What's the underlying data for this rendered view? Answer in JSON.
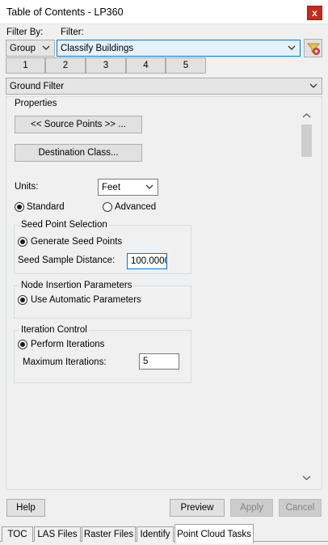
{
  "window": {
    "title": "Table of Contents - LP360",
    "close_label": "x"
  },
  "filter": {
    "filter_by_label": "Filter By:",
    "filter_label": "Filter:",
    "group_value": "Group",
    "filter_value": "Classify Buildings"
  },
  "number_tabs": [
    "1",
    "2",
    "3",
    "4",
    "5"
  ],
  "task_select": "Ground Filter",
  "properties": {
    "legend": "Properties",
    "source_points_label": "<< Source Points >> ...",
    "destination_class_label": "Destination Class...",
    "units_label": "Units:",
    "units_value": "Feet",
    "standard_label": "Standard",
    "advanced_label": "Advanced",
    "mode_selected": "Standard",
    "seed": {
      "legend": "Seed Point Selection",
      "generate_label": "Generate Seed Points",
      "distance_label": "Seed Sample Distance:",
      "distance_value": "100.0000"
    },
    "node": {
      "legend": "Node Insertion Parameters",
      "automatic_label": "Use Automatic Parameters"
    },
    "iteration": {
      "legend": "Iteration Control",
      "perform_label": "Perform Iterations",
      "max_label": "Maximum Iterations:",
      "max_value": "5"
    }
  },
  "footer": {
    "help_label": "Help",
    "preview_label": "Preview",
    "apply_label": "Apply",
    "cancel_label": "Cancel"
  },
  "bottom_tabs": {
    "items": [
      "TOC",
      "LAS Files",
      "Raster Files",
      "Identify",
      "Point Cloud Tasks"
    ],
    "active": "Point Cloud Tasks"
  },
  "colors": {
    "close": "#c42b1c",
    "focus": "#0078d7"
  }
}
